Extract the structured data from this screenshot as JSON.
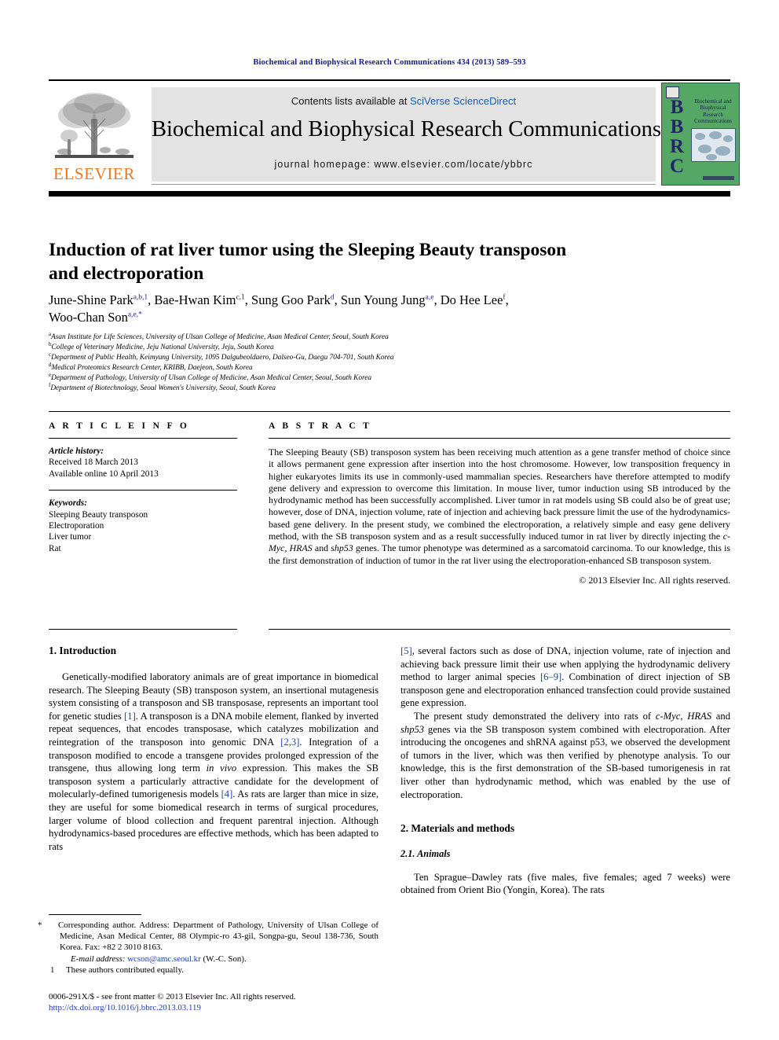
{
  "running_head": "Biochemical and Biophysical Research Communications 434 (2013) 589–593",
  "masthead": {
    "contents_prefix": "Contents lists available at ",
    "contents_link": "SciVerse ScienceDirect",
    "journal_title": "Biochemical and Biophysical Research Communications",
    "journal_homepage": "journal homepage: www.elsevier.com/locate/ybbrc",
    "elsevier_wordmark": "ELSEVIER",
    "cover": {
      "acronym_letters": [
        "B",
        "B",
        "R",
        "C"
      ],
      "title_lines": [
        "Biochemical and",
        "Biophysical",
        "Research",
        "Communications"
      ]
    }
  },
  "article": {
    "title_line_1": "Induction of rat liver tumor using the Sleeping Beauty transposon",
    "title_line_2": "and electroporation",
    "authors": [
      {
        "name": "June-Shine Park",
        "sup": "a,b,1",
        "sep": ", "
      },
      {
        "name": "Bae-Hwan Kim",
        "sup": "c,1",
        "sep": ", "
      },
      {
        "name": "Sung Goo Park",
        "sup": "d",
        "sep": ", "
      },
      {
        "name": "Sun Young Jung",
        "sup": "a,e",
        "sep": ", "
      },
      {
        "name": "Do Hee Lee",
        "sup": "f",
        "sep": ","
      },
      {
        "name": "Woo-Chan Son",
        "sup": "a,e,*",
        "sep": ""
      }
    ],
    "affiliations": [
      {
        "mark": "a",
        "text": "Asan Institute for Life Sciences, University of Ulsan College of Medicine, Asan Medical Center, Seoul, South Korea"
      },
      {
        "mark": "b",
        "text": "College of Veterinary Medicine, Jeju National University, Jeju, South Korea"
      },
      {
        "mark": "c",
        "text": "Department of Public Health, Keimyung University, 1095 Dalgubeoldaero, Dalseo-Gu, Daegu 704-701, South Korea"
      },
      {
        "mark": "d",
        "text": "Medical Proteomics Research Center, KRIBB, Daejeon, South Korea"
      },
      {
        "mark": "e",
        "text": "Department of Pathology, University of Ulsan College of Medicine, Asan Medical Center, Seoul, South Korea"
      },
      {
        "mark": "f",
        "text": "Department of Biotechnology, Seoul Women's University, Seoul, South Korea"
      }
    ]
  },
  "article_info": {
    "heading": "A R T I C L E   I N F O",
    "history_label": "Article history:",
    "received": "Received 18 March 2013",
    "available_online": "Available online 10 April 2013",
    "keywords_label": "Keywords:",
    "keywords": [
      "Sleeping Beauty transposon",
      "Electroporation",
      "Liver tumor",
      "Rat"
    ]
  },
  "abstract": {
    "heading": "A B S T R A C T",
    "text": "The Sleeping Beauty (SB) transposon system has been receiving much attention as a gene transfer method of choice since it allows permanent gene expression after insertion into the host chromosome. However, low transposition frequency in higher eukaryotes limits its use in commonly-used mammalian species. Researchers have therefore attempted to modify gene delivery and expression to overcome this limitation. In mouse liver, tumor induction using SB introduced by the hydrodynamic method has been successfully accomplished. Liver tumor in rat models using SB could also be of great use; however, dose of DNA, injection volume, rate of injection and achieving back pressure limit the use of the hydrodynamics-based gene delivery. In the present study, we combined the electroporation, a relatively simple and easy gene delivery method, with the SB transposon system and as a result successfully induced tumor in rat liver by directly injecting the ",
    "gene_1": "c-Myc",
    "text_mid_1": ", ",
    "gene_2": "HRAS",
    "text_mid_2": " and ",
    "gene_3": "shp53",
    "text_tail": " genes. The tumor phenotype was determined as a sarcomatoid carcinoma. To our knowledge, this is the first demonstration of induction of tumor in the rat liver using the electroporation-enhanced SB transposon system.",
    "copyright": "© 2013 Elsevier Inc. All rights reserved."
  },
  "sections": {
    "introduction_heading": "1. Introduction",
    "intro_p1_a": "Genetically-modified laboratory animals are of great importance in biomedical research. The Sleeping Beauty (SB) transposon system, an insertional mutagenesis system consisting of a transposon and SB transposase, represents an important tool for genetic studies ",
    "intro_ref_1": "[1]",
    "intro_p1_b": ". A transposon is a DNA mobile element, flanked by inverted repeat sequences, that encodes transposase, which catalyzes mobilization and reintegration of the transposon into genomic DNA ",
    "intro_ref_23": "[2,3]",
    "intro_p1_c": ". Integration of a transposon modified to encode a transgene provides prolonged expression of the transgene, thus allowing long term ",
    "intro_italic_invivo": "in vivo",
    "intro_p1_d": " expression. This makes the SB transposon system a particularly attractive candidate for the development of molecularly-defined tumorigenesis models ",
    "intro_ref_4": "[4]",
    "intro_p1_e": ". As rats are larger than mice in size, they are useful for some biomedical research in terms of surgical procedures, larger volume of blood collection and frequent parentral injection. Although hydrodynamics-based procedures are effective methods, which has been adapted to rats ",
    "intro_ref_5": "[5]",
    "intro_p1_f": ", several factors such as dose of DNA, injection volume, rate of injection and achieving back pressure limit their use when applying the hydrodynamic delivery method to larger animal species ",
    "intro_ref_69": "[6–9]",
    "intro_p1_g": ". Combination of direct injection of SB transposon gene and electroporation enhanced transfection could provide sustained gene expression.",
    "intro_p2_a": "The present study demonstrated the delivery into rats of ",
    "intro_p2_gene1": "c-Myc",
    "intro_p2_b": ", ",
    "intro_p2_gene2": "HRAS",
    "intro_p2_c": " and ",
    "intro_p2_gene3": "shp53",
    "intro_p2_d": " genes via the SB transposon system combined with electroporation. After introducing the oncogenes and shRNA against p53, we observed the development of tumors in the liver, which was then verified by phenotype analysis. To our knowledge, this is the first demonstration of the SB-based tumorigenesis in rat liver other than hydrodynamic method, which was enabled by the use of electroporation.",
    "methods_heading": "2. Materials and methods",
    "animals_heading": "2.1. Animals",
    "animals_p1": "Ten Sprague–Dawley rats (five males, five females; aged 7 weeks) were obtained from Orient Bio (Yongin, Korea). The rats"
  },
  "footnotes": {
    "corresponding_mark": "*",
    "corresponding_text": "Corresponding author. Address: Department of Pathology, University of Ulsan College of Medicine, Asan Medical Center, 88 Olympic-ro 43-gil, Songpa-gu, Seoul 138-736, South Korea. Fax: +82 2 3010 8163.",
    "email_label": "E-mail address:",
    "email": "wcson@amc.seoul.kr",
    "email_suffix": " (W.-C. Son).",
    "equal_mark": "1",
    "equal_text": "These authors contributed equally."
  },
  "imprint": {
    "issn_line": "0006-291X/$ - see front matter © 2013 Elsevier Inc. All rights reserved.",
    "doi": "http://dx.doi.org/10.1016/j.bbrc.2013.03.119"
  },
  "colors": {
    "running_head_blue": "#1a1a8c",
    "link_blue": "#1b5faa",
    "ref_blue": "#1c3fa8",
    "elsevier_orange": "#e87722",
    "band_gray": "#e3e3e3",
    "cover_green": "#55a765"
  }
}
